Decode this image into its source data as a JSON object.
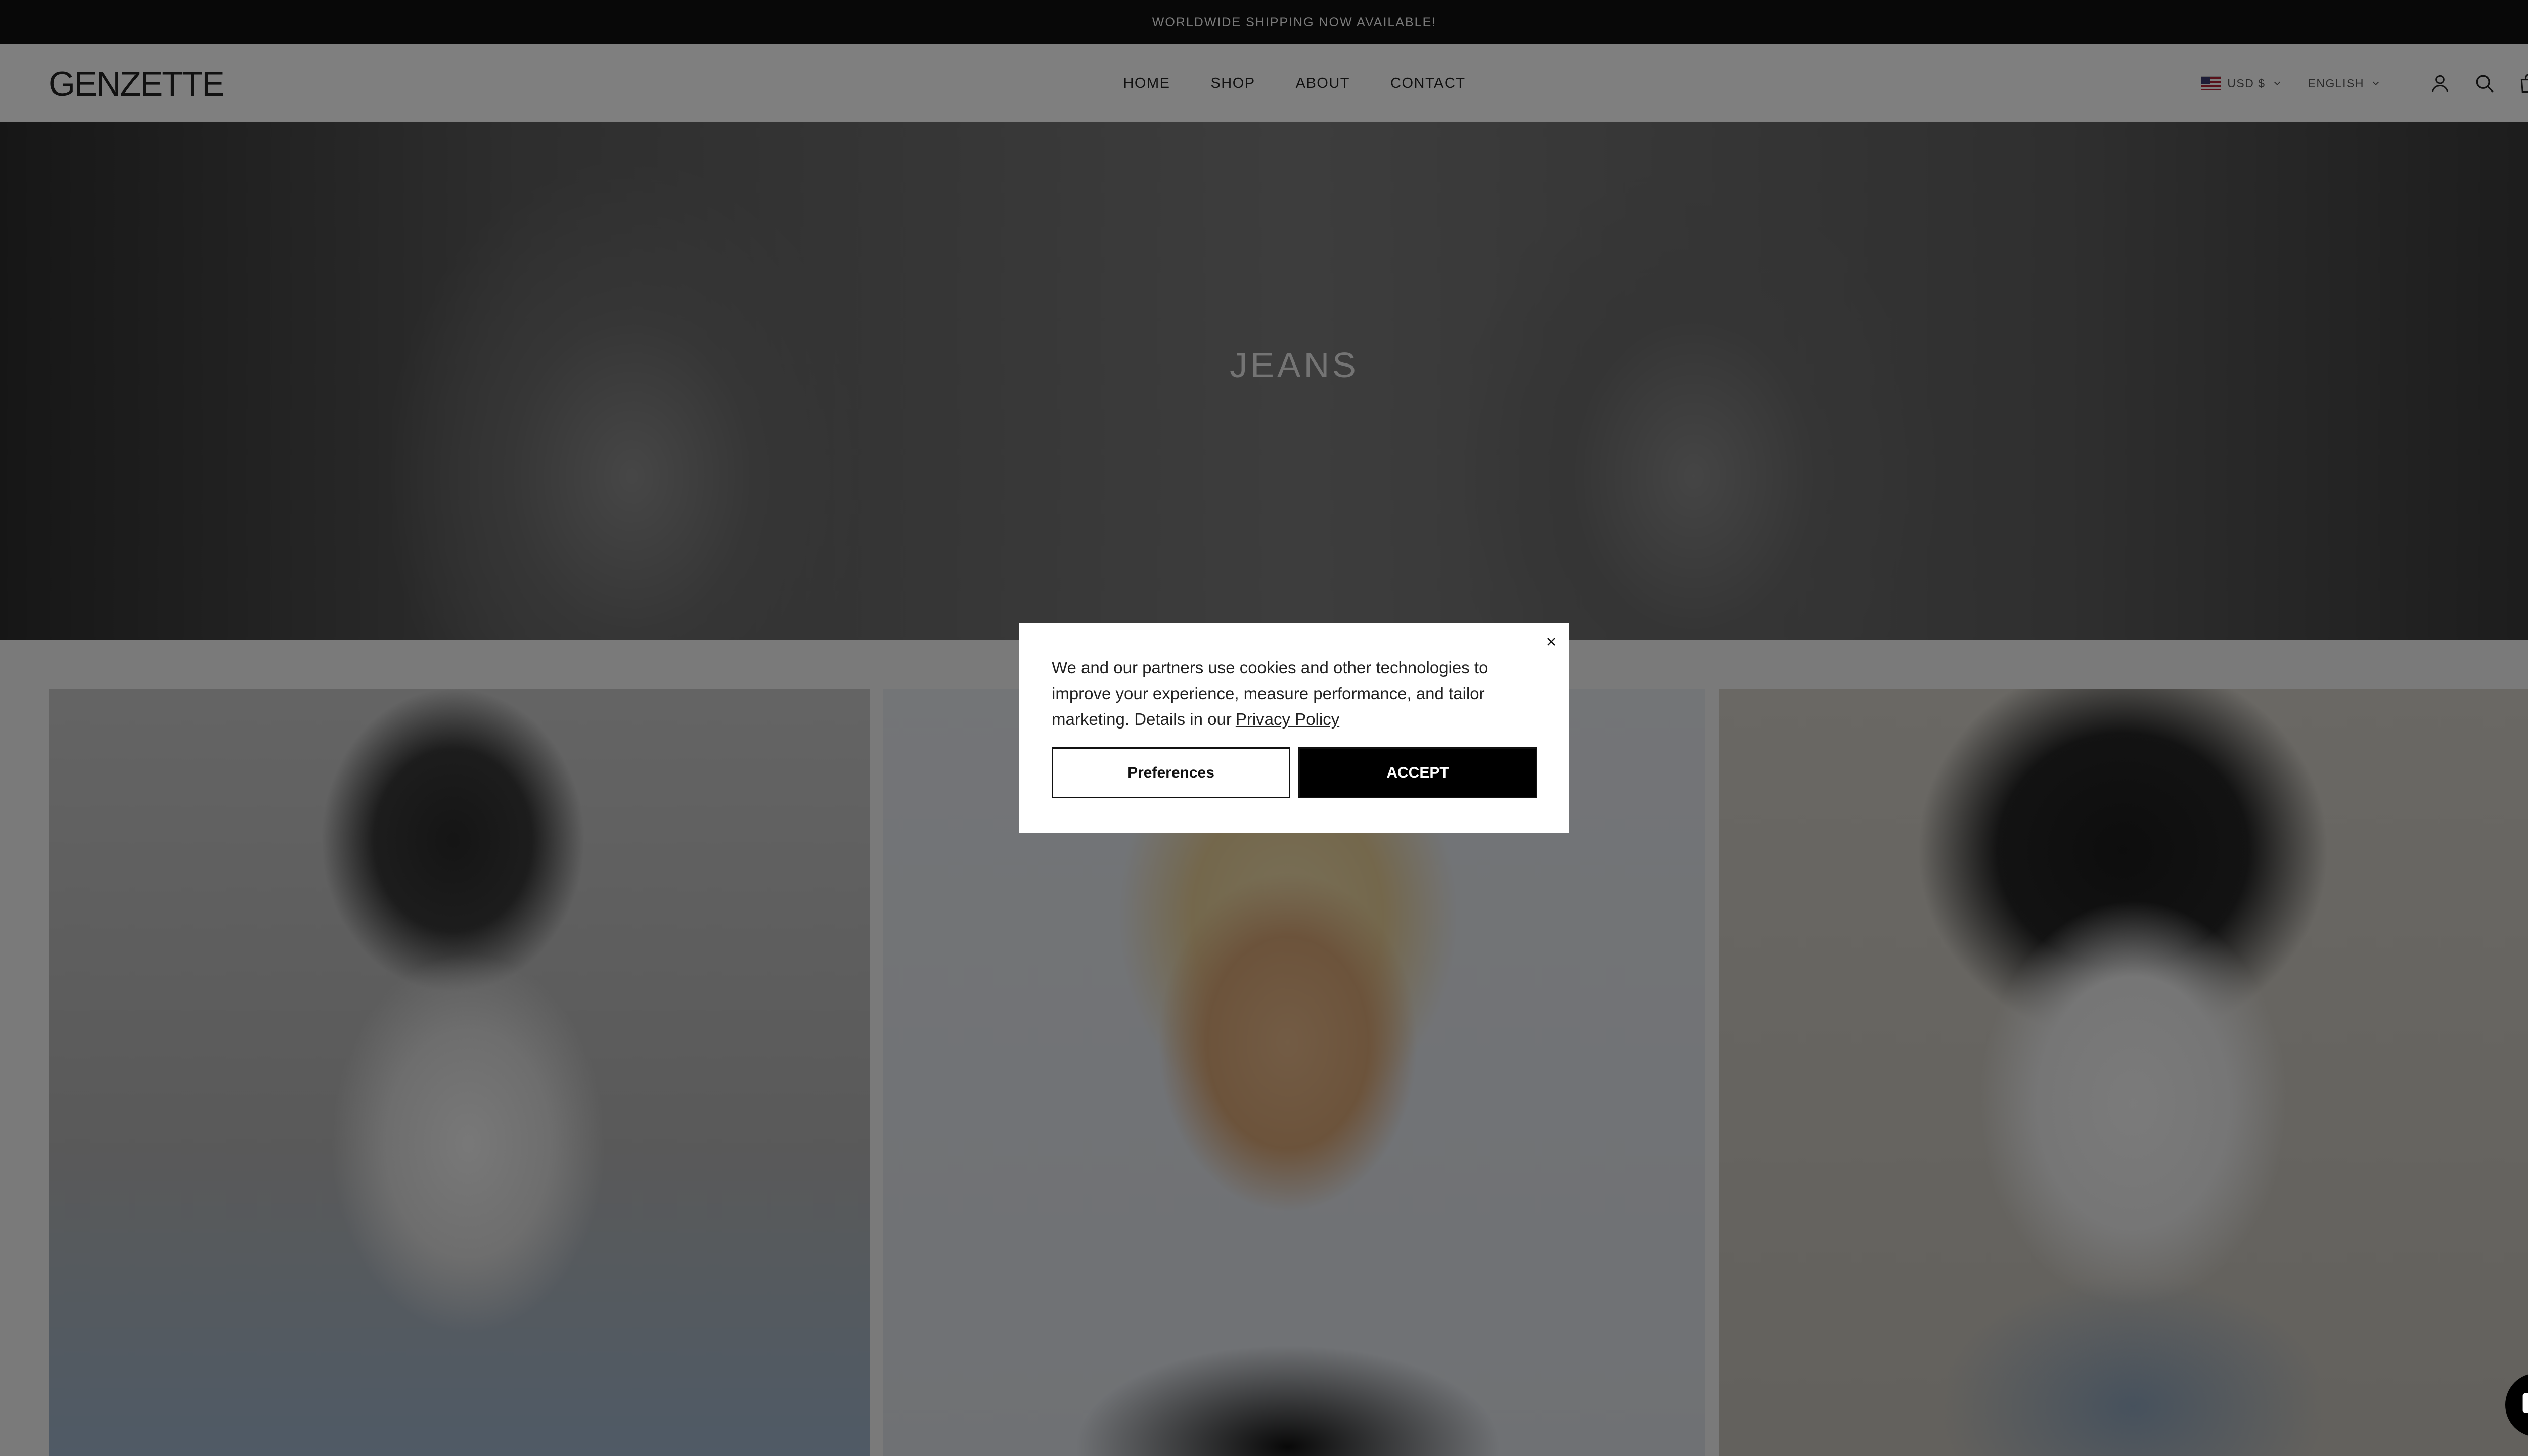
{
  "announcement": {
    "text": "WORLDWIDE SHIPPING NOW AVAILABLE!"
  },
  "header": {
    "logo": "GENZETTE",
    "nav": [
      "HOME",
      "SHOP",
      "ABOUT",
      "CONTACT"
    ],
    "currency": "USD $",
    "language": "ENGLISH"
  },
  "hero": {
    "title": "JEANS"
  },
  "cookie": {
    "message": "We and our partners use cookies and other technologies to improve your experience, measure performance, and tailor marketing. Details in our",
    "link": "Privacy Policy",
    "preferences": "Preferences",
    "accept": "ACCEPT"
  },
  "icons": [
    "us-flag-icon",
    "chevron-down-icon",
    "account-icon",
    "search-icon",
    "cart-icon",
    "close-icon",
    "chat-icon"
  ],
  "colors": {
    "accent": "#000000",
    "announcement_bg": "#111111"
  }
}
